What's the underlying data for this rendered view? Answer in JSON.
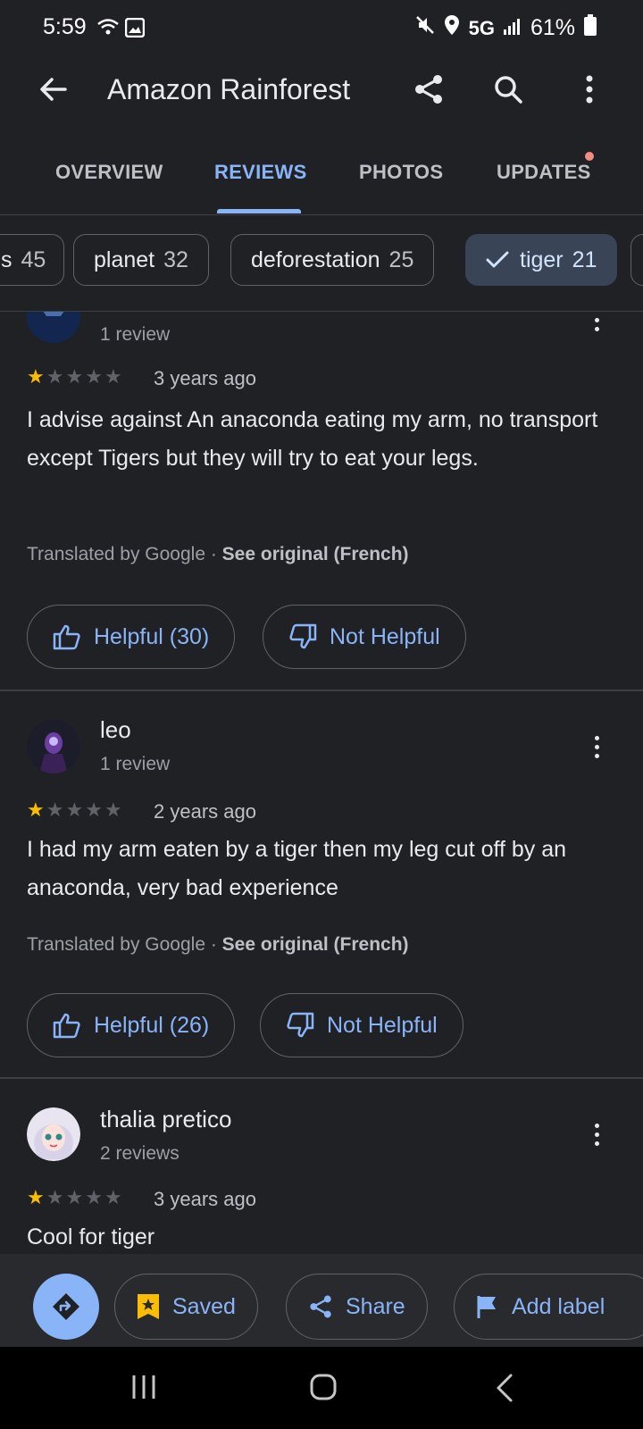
{
  "status_bar": {
    "time": "5:59",
    "network": "5G",
    "battery": "61%"
  },
  "header": {
    "title": "Amazon Rainforest"
  },
  "tabs": [
    {
      "label": "OVERVIEW"
    },
    {
      "label": "REVIEWS"
    },
    {
      "label": "PHOTOS"
    },
    {
      "label": "UPDATES"
    }
  ],
  "chips": [
    {
      "label": "s",
      "count": "45"
    },
    {
      "label": "planet",
      "count": "32"
    },
    {
      "label": "deforestation",
      "count": "25"
    },
    {
      "label": "tiger",
      "count": "21",
      "selected": true
    }
  ],
  "reviews": [
    {
      "name": "",
      "subtitle": "1 review",
      "rating": 1,
      "time": "3 years ago",
      "text": "I advise against An anaconda eating my arm, no transport except Tigers but they will try to eat your legs.",
      "translated_prefix": "Translated by Google · ",
      "translated_link": "See original (French)",
      "helpful": "Helpful (30)",
      "not_helpful": "Not Helpful"
    },
    {
      "name": "leo",
      "subtitle": "1 review",
      "rating": 1,
      "time": "2 years ago",
      "text": "I had my arm eaten by a tiger then my leg cut off by an anaconda, very bad experience",
      "translated_prefix": "Translated by Google · ",
      "translated_link": "See original (French)",
      "helpful": "Helpful (26)",
      "not_helpful": "Not Helpful"
    },
    {
      "name": "thalia pretico",
      "subtitle": "2 reviews",
      "rating": 1,
      "time": "3 years ago",
      "text": "Cool for tiger"
    }
  ],
  "actions": {
    "saved": "Saved",
    "share": "Share",
    "add_label": "Add label"
  },
  "colors": {
    "accent": "#8ab4f8",
    "star": "#fbbc04",
    "background": "#202124"
  }
}
